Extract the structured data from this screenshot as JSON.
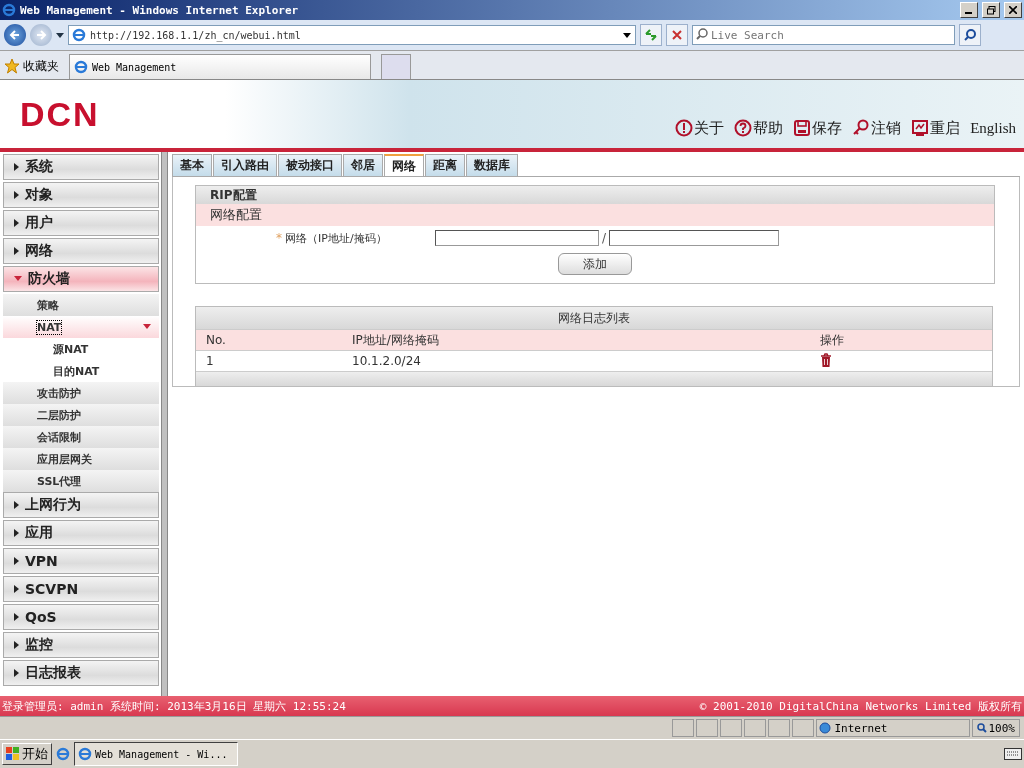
{
  "window": {
    "title": "Web Management - Windows Internet Explorer"
  },
  "browser": {
    "address": "http://192.168.1.1/zh_cn/webui.html",
    "search_placeholder": "Live Search",
    "favorites": "收藏夹",
    "tab": "Web Management"
  },
  "header": {
    "logo": "DCN",
    "links": [
      {
        "kind": "about",
        "label": "关于"
      },
      {
        "kind": "help",
        "label": "帮助"
      },
      {
        "kind": "save",
        "label": "保存"
      },
      {
        "kind": "logout",
        "label": "注销"
      },
      {
        "kind": "restart",
        "label": "重启"
      }
    ],
    "language": "English"
  },
  "sidebar": {
    "items": [
      {
        "label": "系统",
        "expanded": false
      },
      {
        "label": "对象",
        "expanded": false
      },
      {
        "label": "用户",
        "expanded": false
      },
      {
        "label": "网络",
        "expanded": false
      },
      {
        "label": "防火墙",
        "expanded": true,
        "children": [
          {
            "label": "策略",
            "selected": false,
            "expanded": false
          },
          {
            "label": "NAT",
            "selected": true,
            "expanded": true,
            "children": [
              {
                "label": "源NAT"
              },
              {
                "label": "目的NAT"
              }
            ]
          },
          {
            "label": "攻击防护",
            "selected": false,
            "expanded": false
          },
          {
            "label": "二层防护",
            "selected": false,
            "expanded": false
          },
          {
            "label": "会话限制",
            "selected": false,
            "expanded": false
          },
          {
            "label": "应用层网关",
            "selected": false,
            "expanded": false
          },
          {
            "label": "SSL代理",
            "selected": false,
            "expanded": false
          }
        ]
      },
      {
        "label": "上网行为",
        "expanded": false
      },
      {
        "label": "应用",
        "expanded": false
      },
      {
        "label": "VPN",
        "expanded": false
      },
      {
        "label": "SCVPN",
        "expanded": false
      },
      {
        "label": "QoS",
        "expanded": false
      },
      {
        "label": "监控",
        "expanded": false
      },
      {
        "label": "日志报表",
        "expanded": false
      }
    ]
  },
  "tabs": [
    {
      "label": "基本",
      "selected": false
    },
    {
      "label": "引入路由",
      "selected": false
    },
    {
      "label": "被动接口",
      "selected": false
    },
    {
      "label": "邻居",
      "selected": false
    },
    {
      "label": "网络",
      "selected": true
    },
    {
      "label": "距离",
      "selected": false
    },
    {
      "label": "数据库",
      "selected": false
    }
  ],
  "form": {
    "title": "RIP配置",
    "section": "网络配置",
    "required_mark": "*",
    "field_label": "网络（IP地址/掩码）",
    "separator": "/",
    "button": "添加"
  },
  "table": {
    "title": "网络日志列表",
    "columns": [
      "No.",
      "IP地址/网络掩码",
      "操作"
    ],
    "rows": [
      {
        "no": "1",
        "network": "10.1.2.0/24"
      }
    ]
  },
  "footer": {
    "login": "登录管理员: admin 系统时间: 2013年3月16日 星期六 12:55:24",
    "copyright": "© 2001-2010 DigitalChina Networks Limited 版权所有"
  },
  "status_bar": {
    "zone": "Internet",
    "zoom": "100%"
  },
  "taskbar": {
    "start": "开始",
    "task": "Web Management - Wi..."
  }
}
